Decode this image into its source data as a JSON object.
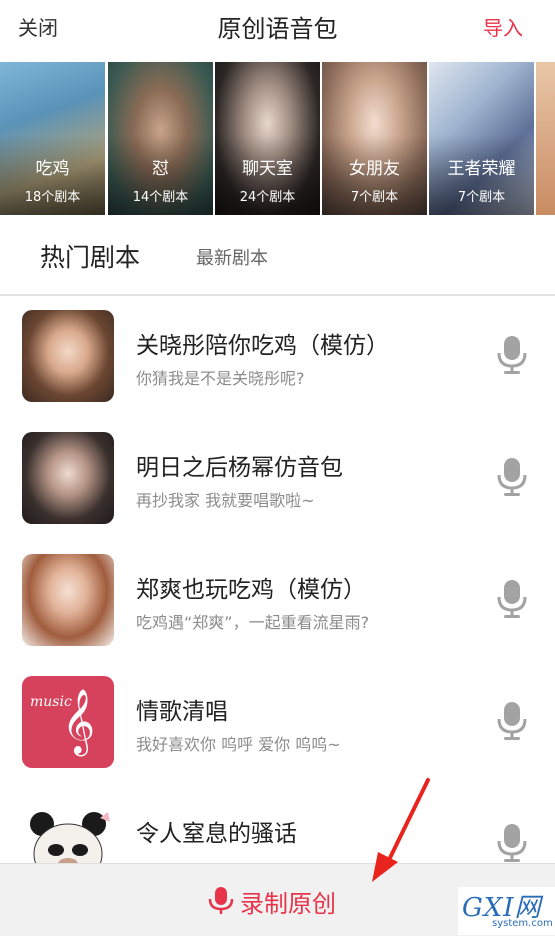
{
  "header": {
    "close_label": "关闭",
    "title": "原创语音包",
    "import_label": "导入"
  },
  "categories": [
    {
      "name": "吃鸡",
      "count": "18个剧本"
    },
    {
      "name": "怼",
      "count": "14个剧本"
    },
    {
      "name": "聊天室",
      "count": "24个剧本"
    },
    {
      "name": "女朋友",
      "count": "7个剧本"
    },
    {
      "name": "王者荣耀",
      "count": "7个剧本"
    }
  ],
  "tabs": {
    "hot": "热门剧本",
    "new": "最新剧本"
  },
  "scripts": [
    {
      "title": "关晓彤陪你吃鸡（模仿）",
      "subtitle": "你猜我是不是关晓彤呢?"
    },
    {
      "title": "明日之后杨幂仿音包",
      "subtitle": "再抄我家 我就要唱歌啦~"
    },
    {
      "title": "郑爽也玩吃鸡（模仿）",
      "subtitle": "吃鸡遇“郑爽”，一起重看流星雨?"
    },
    {
      "title": "情歌清唱",
      "subtitle": "我好喜欢你 呜呼 爱你 呜呜~",
      "thumb_text": "music"
    },
    {
      "title": "令人窒息的骚话",
      "subtitle": ""
    }
  ],
  "bottom": {
    "record_label": "录制原创"
  },
  "watermark": {
    "brand": "GXI网",
    "domain": "system.com"
  },
  "colors": {
    "accent": "#e8344a",
    "mic_gray": "#a3a3a3",
    "bar_bg": "#f1f1f1"
  },
  "icons": {
    "mic": "microphone-icon",
    "arrow": "red-arrow-annotation"
  }
}
